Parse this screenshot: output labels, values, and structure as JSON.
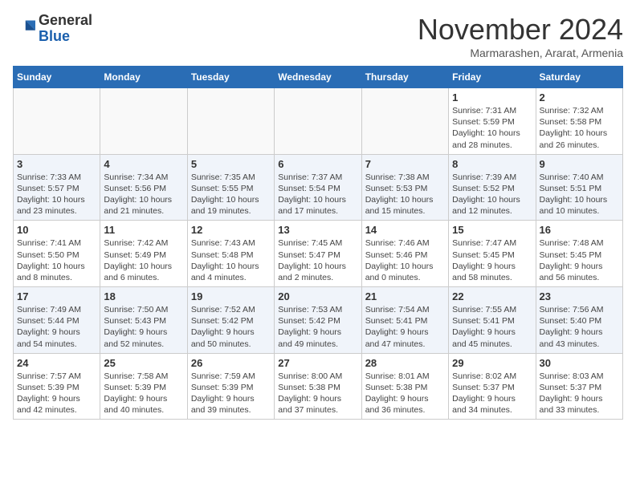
{
  "header": {
    "logo_general": "General",
    "logo_blue": "Blue",
    "month_title": "November 2024",
    "location": "Marmarashen, Ararat, Armenia"
  },
  "weekdays": [
    "Sunday",
    "Monday",
    "Tuesday",
    "Wednesday",
    "Thursday",
    "Friday",
    "Saturday"
  ],
  "weeks": [
    [
      {
        "day": "",
        "info": ""
      },
      {
        "day": "",
        "info": ""
      },
      {
        "day": "",
        "info": ""
      },
      {
        "day": "",
        "info": ""
      },
      {
        "day": "",
        "info": ""
      },
      {
        "day": "1",
        "info": "Sunrise: 7:31 AM\nSunset: 5:59 PM\nDaylight: 10 hours\nand 28 minutes."
      },
      {
        "day": "2",
        "info": "Sunrise: 7:32 AM\nSunset: 5:58 PM\nDaylight: 10 hours\nand 26 minutes."
      }
    ],
    [
      {
        "day": "3",
        "info": "Sunrise: 7:33 AM\nSunset: 5:57 PM\nDaylight: 10 hours\nand 23 minutes."
      },
      {
        "day": "4",
        "info": "Sunrise: 7:34 AM\nSunset: 5:56 PM\nDaylight: 10 hours\nand 21 minutes."
      },
      {
        "day": "5",
        "info": "Sunrise: 7:35 AM\nSunset: 5:55 PM\nDaylight: 10 hours\nand 19 minutes."
      },
      {
        "day": "6",
        "info": "Sunrise: 7:37 AM\nSunset: 5:54 PM\nDaylight: 10 hours\nand 17 minutes."
      },
      {
        "day": "7",
        "info": "Sunrise: 7:38 AM\nSunset: 5:53 PM\nDaylight: 10 hours\nand 15 minutes."
      },
      {
        "day": "8",
        "info": "Sunrise: 7:39 AM\nSunset: 5:52 PM\nDaylight: 10 hours\nand 12 minutes."
      },
      {
        "day": "9",
        "info": "Sunrise: 7:40 AM\nSunset: 5:51 PM\nDaylight: 10 hours\nand 10 minutes."
      }
    ],
    [
      {
        "day": "10",
        "info": "Sunrise: 7:41 AM\nSunset: 5:50 PM\nDaylight: 10 hours\nand 8 minutes."
      },
      {
        "day": "11",
        "info": "Sunrise: 7:42 AM\nSunset: 5:49 PM\nDaylight: 10 hours\nand 6 minutes."
      },
      {
        "day": "12",
        "info": "Sunrise: 7:43 AM\nSunset: 5:48 PM\nDaylight: 10 hours\nand 4 minutes."
      },
      {
        "day": "13",
        "info": "Sunrise: 7:45 AM\nSunset: 5:47 PM\nDaylight: 10 hours\nand 2 minutes."
      },
      {
        "day": "14",
        "info": "Sunrise: 7:46 AM\nSunset: 5:46 PM\nDaylight: 10 hours\nand 0 minutes."
      },
      {
        "day": "15",
        "info": "Sunrise: 7:47 AM\nSunset: 5:45 PM\nDaylight: 9 hours\nand 58 minutes."
      },
      {
        "day": "16",
        "info": "Sunrise: 7:48 AM\nSunset: 5:45 PM\nDaylight: 9 hours\nand 56 minutes."
      }
    ],
    [
      {
        "day": "17",
        "info": "Sunrise: 7:49 AM\nSunset: 5:44 PM\nDaylight: 9 hours\nand 54 minutes."
      },
      {
        "day": "18",
        "info": "Sunrise: 7:50 AM\nSunset: 5:43 PM\nDaylight: 9 hours\nand 52 minutes."
      },
      {
        "day": "19",
        "info": "Sunrise: 7:52 AM\nSunset: 5:42 PM\nDaylight: 9 hours\nand 50 minutes."
      },
      {
        "day": "20",
        "info": "Sunrise: 7:53 AM\nSunset: 5:42 PM\nDaylight: 9 hours\nand 49 minutes."
      },
      {
        "day": "21",
        "info": "Sunrise: 7:54 AM\nSunset: 5:41 PM\nDaylight: 9 hours\nand 47 minutes."
      },
      {
        "day": "22",
        "info": "Sunrise: 7:55 AM\nSunset: 5:41 PM\nDaylight: 9 hours\nand 45 minutes."
      },
      {
        "day": "23",
        "info": "Sunrise: 7:56 AM\nSunset: 5:40 PM\nDaylight: 9 hours\nand 43 minutes."
      }
    ],
    [
      {
        "day": "24",
        "info": "Sunrise: 7:57 AM\nSunset: 5:39 PM\nDaylight: 9 hours\nand 42 minutes."
      },
      {
        "day": "25",
        "info": "Sunrise: 7:58 AM\nSunset: 5:39 PM\nDaylight: 9 hours\nand 40 minutes."
      },
      {
        "day": "26",
        "info": "Sunrise: 7:59 AM\nSunset: 5:39 PM\nDaylight: 9 hours\nand 39 minutes."
      },
      {
        "day": "27",
        "info": "Sunrise: 8:00 AM\nSunset: 5:38 PM\nDaylight: 9 hours\nand 37 minutes."
      },
      {
        "day": "28",
        "info": "Sunrise: 8:01 AM\nSunset: 5:38 PM\nDaylight: 9 hours\nand 36 minutes."
      },
      {
        "day": "29",
        "info": "Sunrise: 8:02 AM\nSunset: 5:37 PM\nDaylight: 9 hours\nand 34 minutes."
      },
      {
        "day": "30",
        "info": "Sunrise: 8:03 AM\nSunset: 5:37 PM\nDaylight: 9 hours\nand 33 minutes."
      }
    ]
  ]
}
